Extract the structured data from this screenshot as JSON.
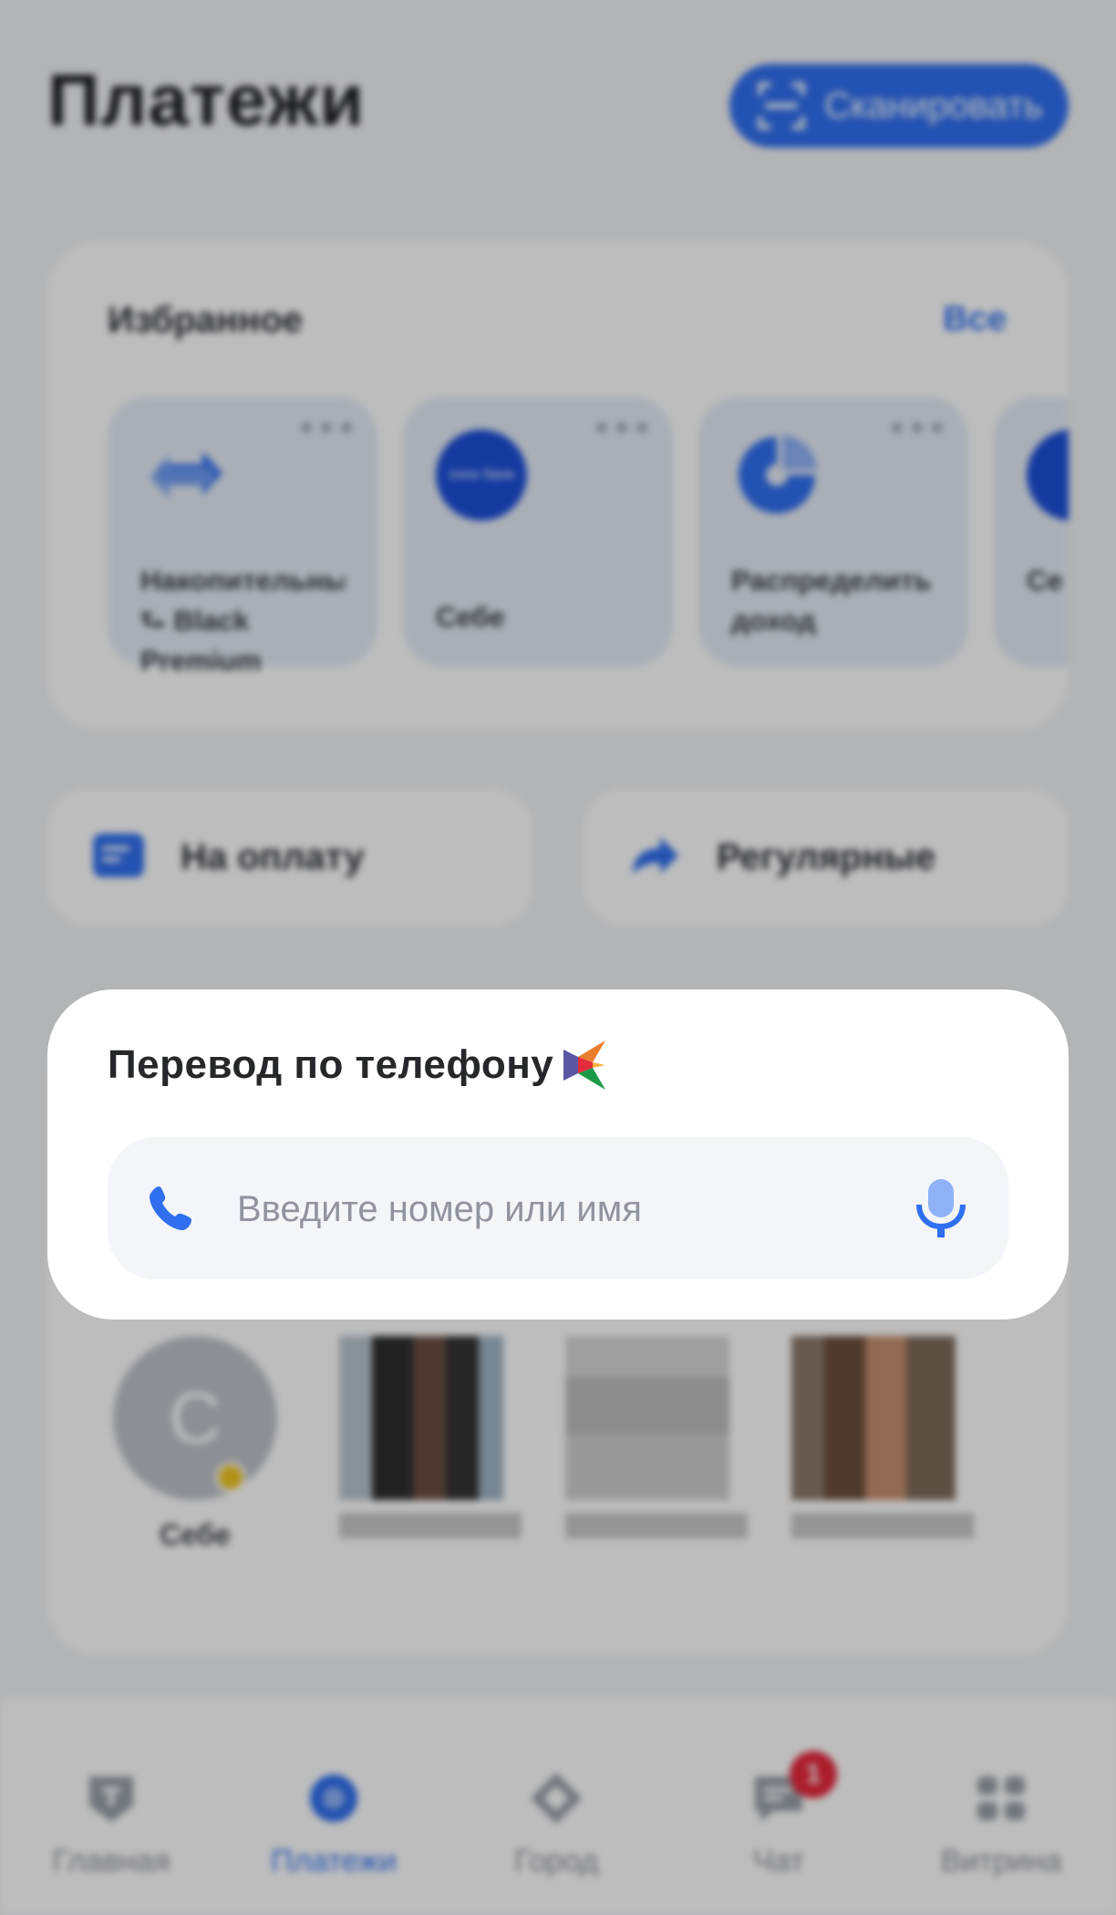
{
  "header": {
    "title": "Платежи",
    "scan_label": "Сканировать"
  },
  "favorites": {
    "title": "Избранное",
    "all_label": "Все",
    "items": [
      {
        "label": "Накопительный ⮑ Black Premium",
        "icon": "transfer-arrows-icon"
      },
      {
        "label": "Себе",
        "icon": "bank-logo-icon",
        "logo_text": "озон банк"
      },
      {
        "label": "Распределить доход",
        "icon": "pie-chart-icon"
      },
      {
        "label": "Се (Е",
        "icon": "bank-logo-icon"
      }
    ]
  },
  "quick_actions": [
    {
      "label": "На оплату",
      "icon": "invoice-icon"
    },
    {
      "label": "Регулярные",
      "icon": "recurring-icon"
    }
  ],
  "phone_transfer": {
    "title": "Перевод по телефону",
    "placeholder": "Введите номер или имя",
    "value": ""
  },
  "contacts": [
    {
      "name": "Себе",
      "initial": "С"
    }
  ],
  "tabbar": {
    "items": [
      {
        "label": "Главная",
        "icon": "home-shield-icon",
        "active": false
      },
      {
        "label": "Платежи",
        "icon": "payments-icon",
        "active": true
      },
      {
        "label": "Город",
        "icon": "city-icon",
        "active": false
      },
      {
        "label": "Чат",
        "icon": "chat-icon",
        "active": false,
        "badge": "1"
      },
      {
        "label": "Витрина",
        "icon": "showcase-icon",
        "active": false
      }
    ]
  },
  "colors": {
    "accent": "#2f6ff0",
    "badge": "#e8283d",
    "dim_overlay": "rgba(0,0,0,0.26)"
  }
}
